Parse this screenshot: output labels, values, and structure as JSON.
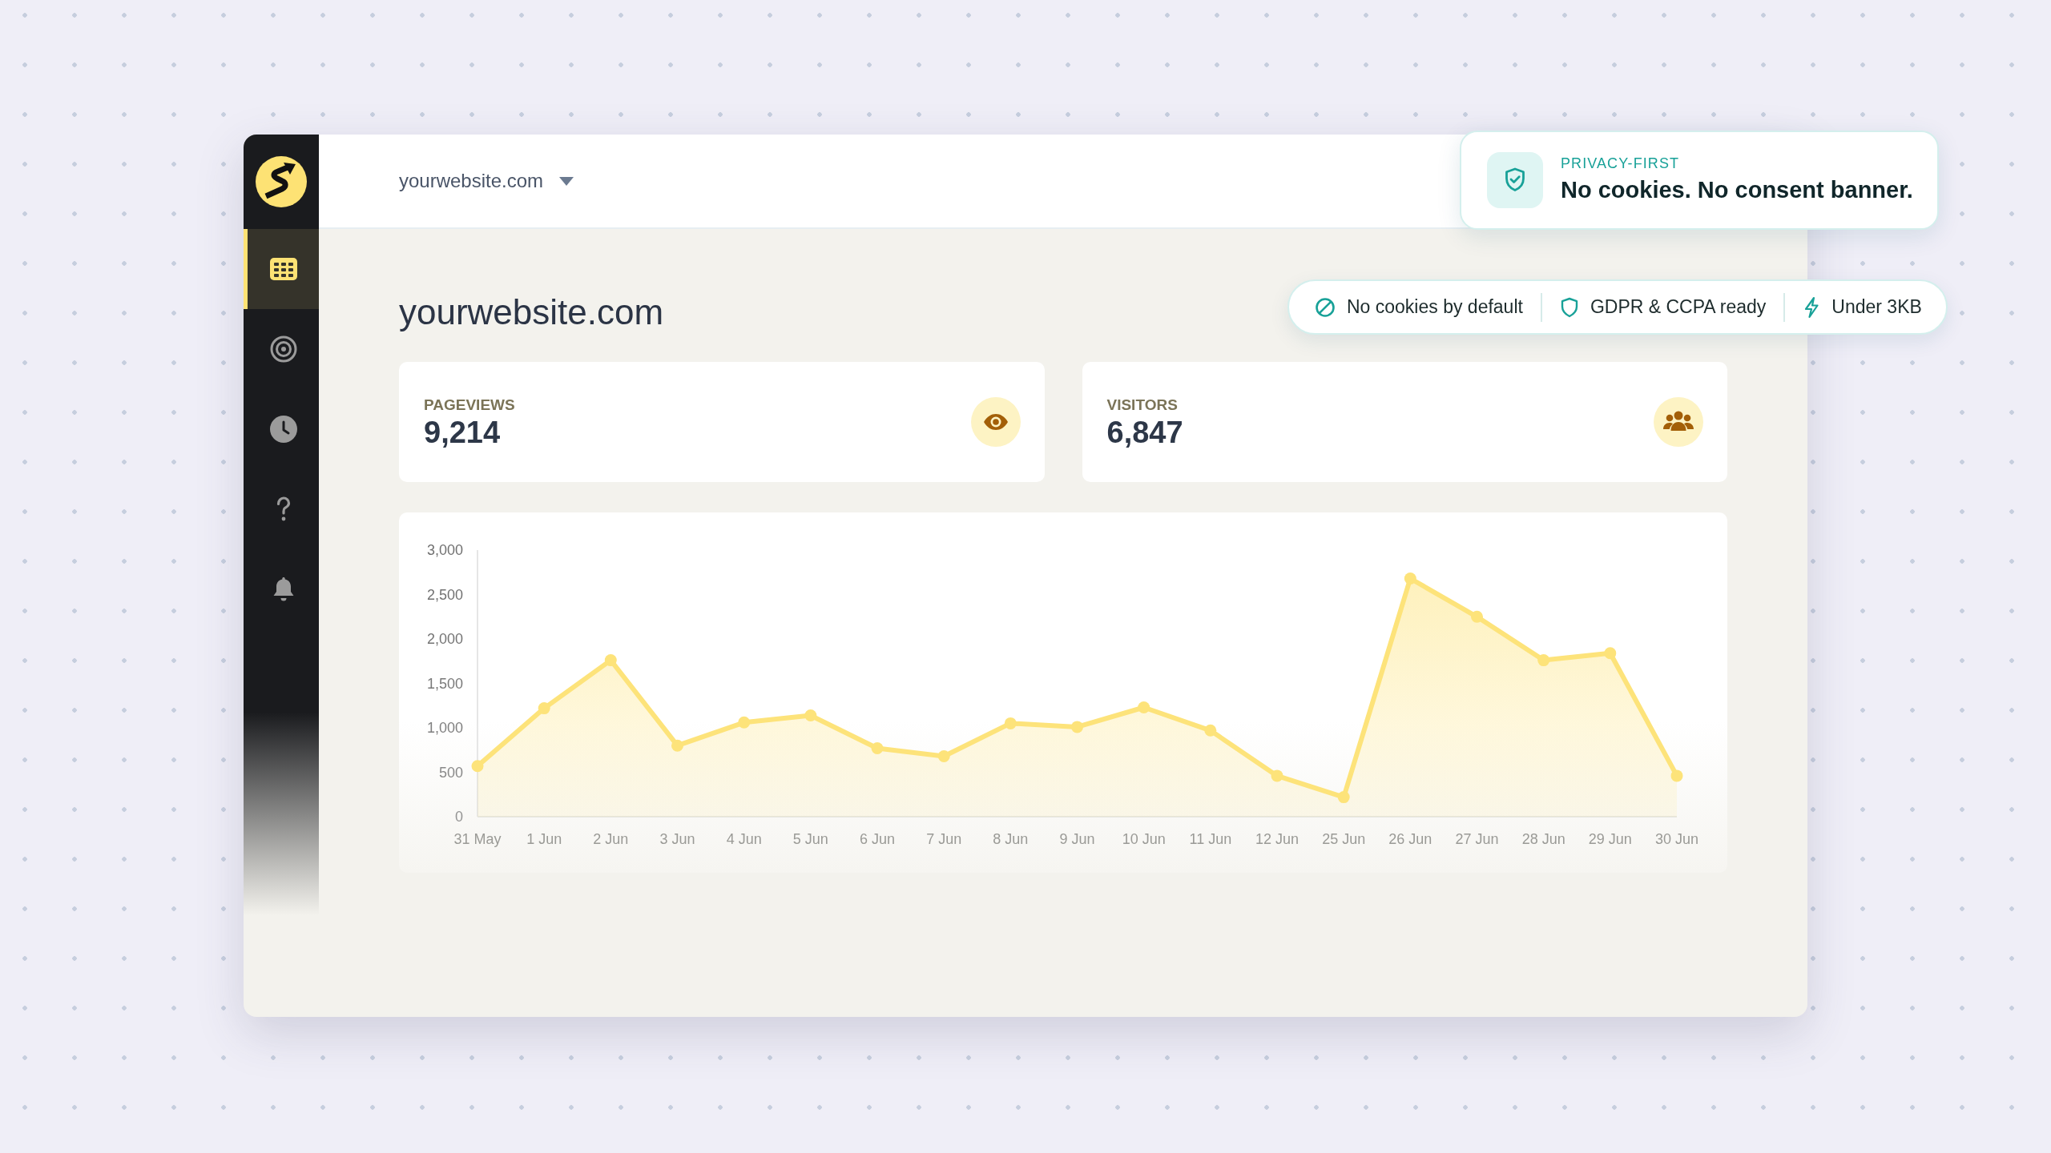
{
  "sidebar": {
    "items": [
      {
        "kind": "grid",
        "selected": true
      },
      {
        "kind": "target",
        "selected": false
      },
      {
        "kind": "clock",
        "selected": false
      },
      {
        "kind": "question",
        "selected": false
      },
      {
        "kind": "bell",
        "selected": false
      }
    ]
  },
  "header": {
    "site_selector": {
      "value": "yourwebsite.com"
    }
  },
  "page": {
    "title": "yourwebsite.com",
    "stats": [
      {
        "kind": "eye",
        "label": "PAGEVIEWS",
        "value": "9,214"
      },
      {
        "kind": "users",
        "label": "VISITORS",
        "value": "6,847"
      }
    ],
    "chart": {
      "chart_data": {
        "type": "area",
        "categories": [
          "31 May",
          "1 Jun",
          "2 Jun",
          "3 Jun",
          "4 Jun",
          "5 Jun",
          "6 Jun",
          "7 Jun",
          "8 Jun",
          "9 Jun",
          "10 Jun",
          "11 Jun",
          "12 Jun",
          "25 Jun",
          "26 Jun",
          "27 Jun",
          "28 Jun",
          "29 Jun",
          "30 Jun"
        ],
        "series": [
          {
            "color": "#fde37a",
            "values": [
              570,
              1220,
              1760,
              800,
              1060,
              1140,
              770,
              680,
              1050,
              1010,
              1230,
              970,
              460,
              220,
              2680,
              2250,
              1760,
              1840,
              460
            ]
          }
        ],
        "ylim": [
          0,
          3000
        ],
        "yticks": [
          {
            "value": 0,
            "label": "0"
          },
          {
            "value": 500,
            "label": "500"
          },
          {
            "value": 1000,
            "label": "1,000"
          },
          {
            "value": 1500,
            "label": "1,500"
          },
          {
            "value": 2000,
            "label": "2,000"
          },
          {
            "value": 2500,
            "label": "2,500"
          },
          {
            "value": 3000,
            "label": "3,000"
          }
        ]
      }
    }
  },
  "privacy_card": {
    "eyebrow": "PRIVACY-FIRST",
    "headline": "No cookies. No consent banner."
  },
  "features": [
    {
      "kind": "ban",
      "label": "No cookies by default"
    },
    {
      "kind": "shield",
      "label": "GDPR & CCPA ready"
    },
    {
      "kind": "bolt",
      "label": "Under 3KB"
    }
  ]
}
